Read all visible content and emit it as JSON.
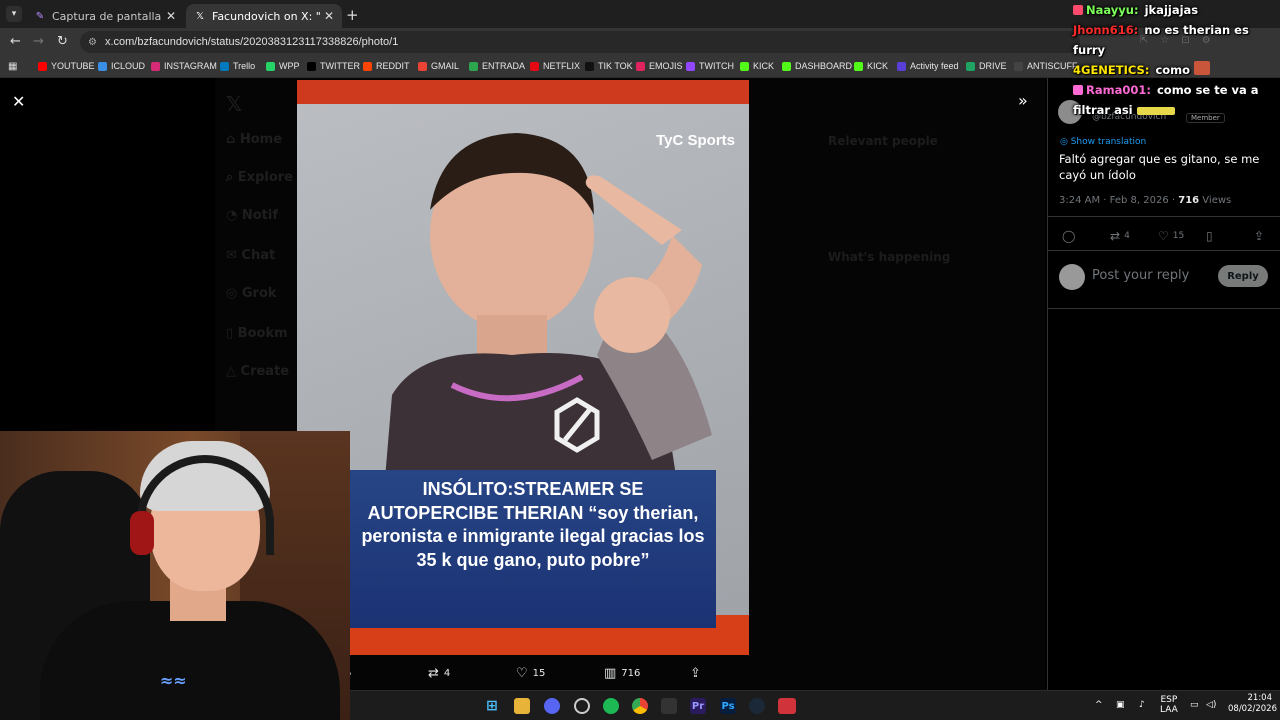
{
  "browser": {
    "tabs": [
      {
        "title": "Captura de pantalla por Lightshot",
        "icon": "lightshot-feather-icon"
      },
      {
        "title": "Facundovich on X: \"Faltó agregar",
        "icon": "x-logo-icon",
        "active": true
      }
    ],
    "url": "x.com/bzfacundovich/status/2020383123117338826/photo/1",
    "bookmarks": [
      {
        "label": "YOUTUBE",
        "color": "#ff0000"
      },
      {
        "label": "ICLOUD",
        "color": "#3a8ee6"
      },
      {
        "label": "INSTAGRAM",
        "color": "#d62976"
      },
      {
        "label": "Trello",
        "color": "#0079bf"
      },
      {
        "label": "WPP",
        "color": "#25d366"
      },
      {
        "label": "TWITTER",
        "color": "#000000"
      },
      {
        "label": "REDDIT",
        "color": "#ff4500"
      },
      {
        "label": "GMAIL",
        "color": "#ea4335"
      },
      {
        "label": "ENTRADA",
        "color": "#2da44e"
      },
      {
        "label": "NETFLIX",
        "color": "#e50914"
      },
      {
        "label": "TIK TOK",
        "color": "#111111"
      },
      {
        "label": "EMOJIS",
        "color": "#e0245e"
      },
      {
        "label": "TWITCH",
        "color": "#9146ff"
      },
      {
        "label": "KICK",
        "color": "#53fc18"
      },
      {
        "label": "DASHBOARD",
        "color": "#53fc18"
      },
      {
        "label": "KICK",
        "color": "#53fc18"
      },
      {
        "label": "Activity feed",
        "color": "#5a3fd6"
      },
      {
        "label": "DRIVE",
        "color": "#1fa463"
      },
      {
        "label": "ANTISCUFF",
        "color": "#444444"
      }
    ]
  },
  "photo": {
    "watermark": "TyC Sports",
    "headline": "INSÓLITO:STREAMER SE AUTOPERCIBE THERIAN “soy therian, peronista e inmigrante ilegal gracias los 35 k que gano, puto pobre”",
    "actions": {
      "replies": "",
      "reposts": "4",
      "likes": "15",
      "views": "716"
    }
  },
  "tweet": {
    "handle": "@bzfacundovich",
    "member_badge": "Member",
    "show_translation": "Show translation",
    "text": "Faltó agregar que es gitano, se me cayó un ídolo",
    "meta_time": "3:24 AM · Feb 8, 2026 · ",
    "views_count": "716",
    "views_label": " Views",
    "reposts": "4",
    "likes": "15",
    "reply_placeholder": "Post your reply",
    "reply_button": "Reply"
  },
  "chat": [
    {
      "user": "Naayyu:",
      "msg": "jkajjajas",
      "color": "#7dff5a"
    },
    {
      "user": "Jhonn616:",
      "msg": "no es therian es",
      "color": "#ff2b2b"
    },
    {
      "user": "",
      "msg": "furry",
      "color": "#ffffff"
    },
    {
      "user": "4GENETICS:",
      "msg": "como",
      "color": "#ffe600"
    },
    {
      "user": "Rama001:",
      "msg": "como se te va a",
      "color": "#ff6ad5"
    },
    {
      "user": "",
      "msg": "filtrar asi",
      "color": "#ffffff"
    }
  ],
  "taskbar": {
    "lang_top": "ESP",
    "lang_bottom": "LAA",
    "time": "21:04",
    "date": "08/02/2026"
  },
  "colors": {
    "x_blue": "#1d9bf0",
    "headline_bg": "#1b3273",
    "tyc_red": "#d63f18"
  }
}
